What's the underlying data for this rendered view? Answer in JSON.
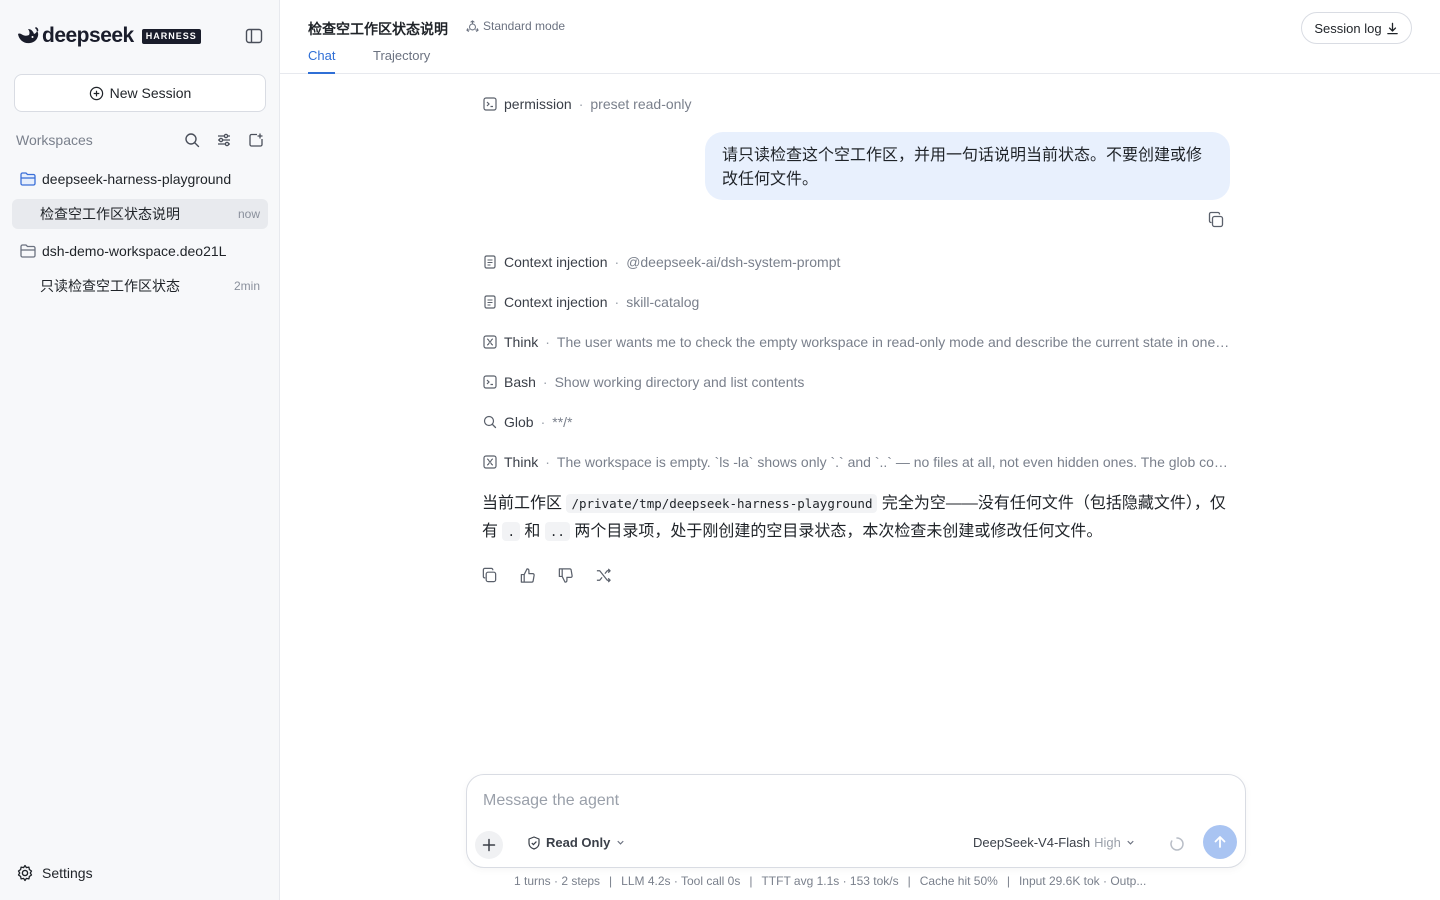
{
  "brand": {
    "name": "deepseek",
    "badge": "HARNESS"
  },
  "sidebar": {
    "new_session_label": "New Session",
    "workspaces_title": "Workspaces",
    "workspaces": [
      {
        "name": "deepseek-harness-playground",
        "sessions": [
          {
            "title": "检查空工作区状态说明",
            "time": "now",
            "active": true
          }
        ]
      },
      {
        "name": "dsh-demo-workspace.deo21L",
        "sessions": [
          {
            "title": "只读检查空工作区状态",
            "time": "2min",
            "active": false
          }
        ]
      }
    ],
    "settings_label": "Settings"
  },
  "header": {
    "title": "检查空工作区状态说明",
    "mode": "Standard mode",
    "tabs": [
      {
        "label": "Chat",
        "active": true
      },
      {
        "label": "Trajectory",
        "active": false
      }
    ],
    "session_log_label": "Session log"
  },
  "chat": {
    "permission": {
      "label": "permission",
      "detail": "preset read-only"
    },
    "user_message": "请只读检查这个空工作区，并用一句话说明当前状态。不要创建或修改任何文件。",
    "steps": [
      {
        "icon": "document-icon",
        "label": "Context injection",
        "detail": "@deepseek-ai/dsh-system-prompt"
      },
      {
        "icon": "document-icon",
        "label": "Context injection",
        "detail": "skill-catalog"
      },
      {
        "icon": "brain-icon",
        "label": "Think",
        "detail": "The user wants me to check the empty workspace in read-only mode and describe the current state in one sentence. Let me look around."
      },
      {
        "icon": "terminal-icon",
        "label": "Bash",
        "detail": "Show working directory and list contents"
      },
      {
        "icon": "search-icon",
        "label": "Glob",
        "detail": "**/*"
      },
      {
        "icon": "brain-icon",
        "label": "Think",
        "detail": "The workspace is empty. `ls -la` shows only `.` and `..` — no files at all, not even hidden ones. The glob confirms it."
      }
    ],
    "answer": {
      "part1": "当前工作区 ",
      "path": "/private/tmp/deepseek-harness-playground",
      "part2": " 完全为空——没有任何文件（包括隐藏文件），仅有 ",
      "dot": ".",
      "part3": " 和 ",
      "dotdot": "..",
      "part4": " 两个目录项，处于刚创建的空目录状态，本次检查未创建或修改任何文件。"
    }
  },
  "composer": {
    "placeholder": "Message the agent",
    "permission_mode": "Read Only",
    "model": "DeepSeek-V4-Flash",
    "effort": "High"
  },
  "stats": {
    "turns": "1 turns · 2 steps",
    "llm": "LLM 4.2s · Tool call 0s",
    "ttft": "TTFT avg 1.1s · 153 tok/s",
    "cache": "Cache hit 50%",
    "tokens": "Input 29.6K tok · Outp..."
  },
  "colors": {
    "accent": "#2f6fd6",
    "user_bubble": "#e8f0fd",
    "folder_active": "#3b6fd8"
  }
}
